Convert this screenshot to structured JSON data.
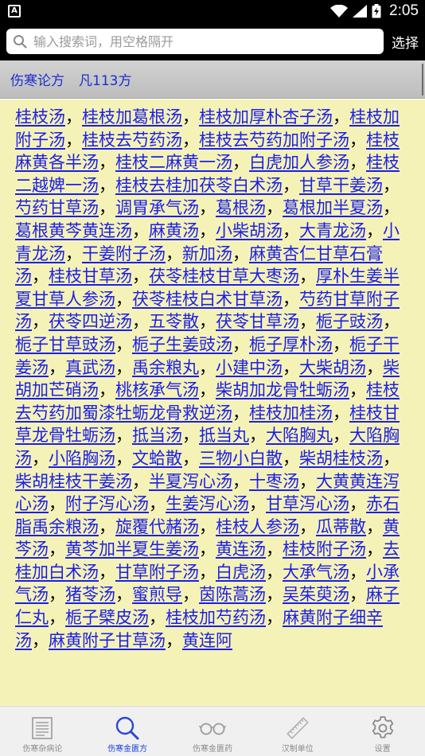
{
  "status_bar": {
    "left_icon": "A",
    "time": "2:05",
    "icons": [
      "wifi-icon",
      "signal-icon",
      "battery-icon"
    ]
  },
  "search": {
    "placeholder": "输入搜索词，用空格隔开",
    "value": "",
    "select_label": "选择"
  },
  "header": {
    "title": "伤寒论方",
    "count": "凡113方"
  },
  "formulas": [
    "桂枝汤",
    "桂枝加葛根汤",
    "桂枝加厚朴杏子汤",
    "桂枝加附子汤",
    "桂枝去芍药汤",
    "桂枝去芍药加附子汤",
    "桂枝麻黄各半汤",
    "桂枝二麻黄一汤",
    "白虎加人参汤",
    "桂枝二越婢一汤",
    "桂枝去桂加茯苓白术汤",
    "甘草干姜汤",
    "芍药甘草汤",
    "调胃承气汤",
    "葛根汤",
    "葛根加半夏汤",
    "葛根黄芩黄连汤",
    "麻黄汤",
    "小柴胡汤",
    "大青龙汤",
    "小青龙汤",
    "干姜附子汤",
    "新加汤",
    "麻黄杏仁甘草石膏汤",
    "桂枝甘草汤",
    "茯苓桂枝甘草大枣汤",
    "厚朴生姜半夏甘草人参汤",
    "茯苓桂枝白术甘草汤",
    "芍药甘草附子汤",
    "茯苓四逆汤",
    "五苓散",
    "茯苓甘草汤",
    "栀子豉汤",
    "栀子甘草豉汤",
    "栀子生姜豉汤",
    "栀子厚朴汤",
    "栀子干姜汤",
    "真武汤",
    "禹余粮丸",
    "小建中汤",
    "大柴胡汤",
    "柴胡加芒硝汤",
    "桃核承气汤",
    "柴胡加龙骨牡蛎汤",
    "桂枝去芍药加蜀漆牡蛎龙骨救逆汤",
    "桂枝加桂汤",
    "桂枝甘草龙骨牡蛎汤",
    "抵当汤",
    "抵当丸",
    "大陷胸丸",
    "大陷胸汤",
    "小陷胸汤",
    "文蛤散",
    "三物小白散",
    "柴胡桂枝汤",
    "柴胡桂枝干姜汤",
    "半夏泻心汤",
    "十枣汤",
    "大黄黄连泻心汤",
    "附子泻心汤",
    "生姜泻心汤",
    "甘草泻心汤",
    "赤石脂禹余粮汤",
    "旋覆代赭汤",
    "桂枝人参汤",
    "瓜蒂散",
    "黄芩汤",
    "黄芩加半夏生姜汤",
    "黄连汤",
    "桂枝附子汤",
    "去桂加白术汤",
    "甘草附子汤",
    "白虎汤",
    "大承气汤",
    "小承气汤",
    "猪苓汤",
    "蜜煎导",
    "茵陈蒿汤",
    "吴茱萸汤",
    "麻子仁丸",
    "栀子檗皮汤",
    "桂枝加芍药汤",
    "麻黄附子细辛汤",
    "麻黄附子甘草汤",
    "黄连阿"
  ],
  "separator": "，",
  "nav": [
    {
      "label": "伤寒杂病论",
      "icon": "book-list-icon",
      "active": false
    },
    {
      "label": "伤寒金匮方",
      "icon": "search-icon",
      "active": true
    },
    {
      "label": "伤寒金匮药",
      "icon": "glasses-icon",
      "active": false
    },
    {
      "label": "汉制单位",
      "icon": "ruler-icon",
      "active": false
    },
    {
      "label": "设置",
      "icon": "gear-icon",
      "active": false
    }
  ],
  "colors": {
    "link": "#1a1fe8",
    "content_bg": "#f5f2b8",
    "header_text": "#1a2fd0",
    "nav_active": "#1a3fd8"
  }
}
